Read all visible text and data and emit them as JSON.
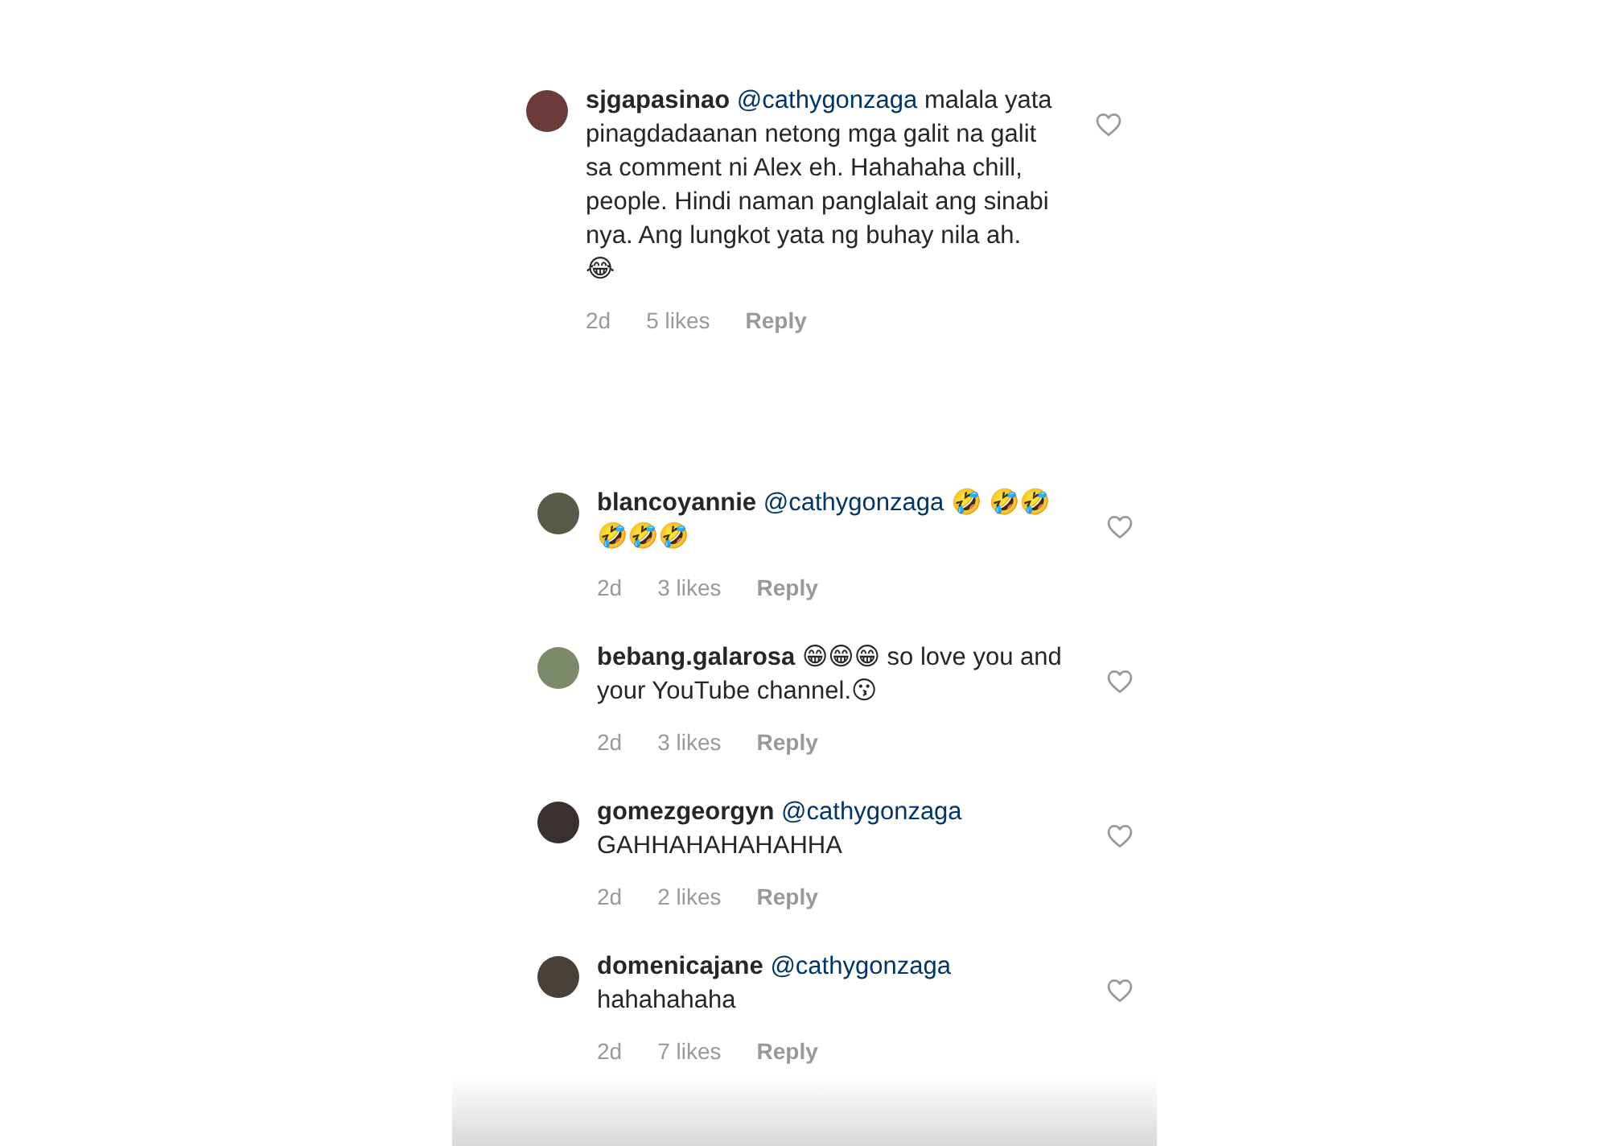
{
  "sections": [
    {
      "comments": [
        {
          "username": "sjgapasinao",
          "mention": "@cathygonzaga",
          "text": "malala yata pinagdadaanan netong mga galit na galit sa comment ni Alex eh. Hahahaha chill, people. Hindi naman panglalait ang sinabi nya. Ang lungkot yata ng buhay nila ah. 😂",
          "time": "2d",
          "likes": "5 likes",
          "reply": "Reply",
          "liked": false
        }
      ]
    },
    {
      "comments": [
        {
          "username": "blancoyannie",
          "mention": "@cathygonzaga",
          "text": "🤣 🤣🤣🤣🤣🤣",
          "time": "2d",
          "likes": "3 likes",
          "reply": "Reply",
          "liked": false
        },
        {
          "username": "bebang.galarosa",
          "text": "😁😁😁 so love you and your YouTube channel.😗",
          "time": "2d",
          "likes": "3 likes",
          "reply": "Reply",
          "liked": false
        },
        {
          "username": "gomezgeorgyn",
          "mention": "@cathygonzaga",
          "text": "GAHHAHAHAHAHHA",
          "time": "2d",
          "likes": "2 likes",
          "reply": "Reply",
          "liked": false
        },
        {
          "username": "domenicajane",
          "mention": "@cathygonzaga",
          "text": "hahahahaha",
          "time": "2d",
          "likes": "7 likes",
          "reply": "Reply",
          "liked": false
        }
      ]
    }
  ]
}
